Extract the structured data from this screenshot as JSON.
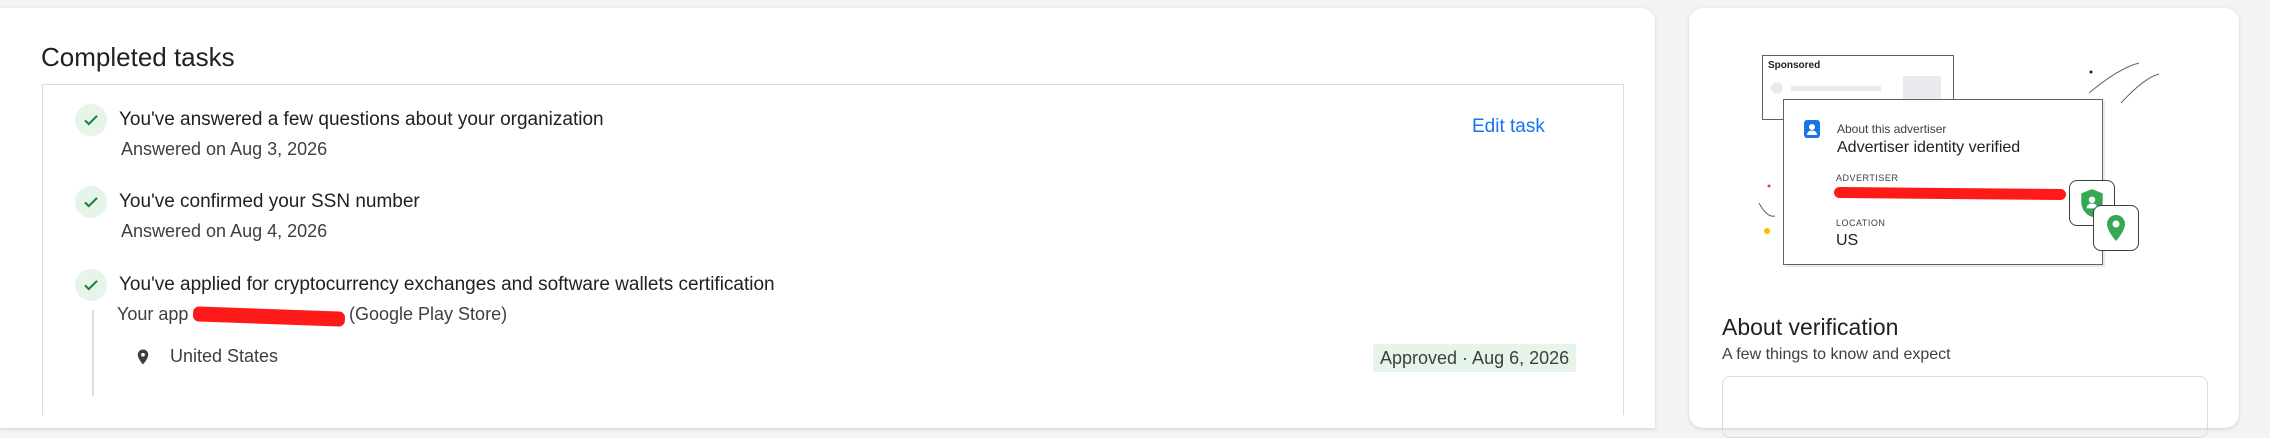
{
  "main": {
    "title": "Completed tasks",
    "edit_label": "Edit task",
    "tasks": [
      {
        "heading": "You've answered a few questions about your organization",
        "sub": "Answered on Aug 3, 2026"
      },
      {
        "heading": "You've confirmed your SSN number",
        "sub": "Answered on Aug 4, 2026"
      },
      {
        "heading": "You've applied for cryptocurrency exchanges and software wallets certification",
        "sub_prefix": "Your app",
        "sub_suffix": "(Google Play Store)"
      }
    ],
    "location": "United States",
    "status": "Approved · Aug 6, 2026"
  },
  "side": {
    "ad_sponsored": "Sponsored",
    "ad_about": "About this advertiser",
    "ad_verified": "Advertiser identity verified",
    "ad_advertiser_label": "ADVERTISER",
    "ad_location_label": "LOCATION",
    "ad_location_value": "US",
    "about_title": "About verification",
    "about_sub": "A few things to know and expect"
  },
  "colors": {
    "accent": "#1a73e8",
    "success": "#188038",
    "success_bg": "#e6f4ea",
    "redaction": "#ff1a1a"
  },
  "icons": [
    "check-icon",
    "location-pin-icon",
    "person-icon",
    "shield-icon",
    "map-pin-icon"
  ]
}
